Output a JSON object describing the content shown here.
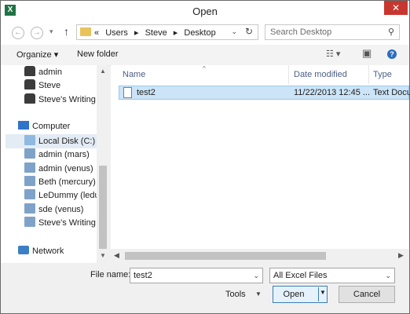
{
  "window": {
    "title": "Open",
    "app_icon": "excel-icon",
    "close_glyph": "✕"
  },
  "nav": {
    "back_glyph": "←",
    "forward_glyph": "→",
    "recent_glyph": "▾",
    "up_glyph": "↑",
    "crumb_prefix": "«",
    "breadcrumbs": [
      "Users",
      "Steve",
      "Desktop"
    ],
    "crumb_sep": "▸",
    "address_dropdown_glyph": "⌄",
    "refresh_glyph": "↻",
    "search_placeholder": "Search Desktop",
    "search_icon_glyph": "⚲"
  },
  "toolbar": {
    "organize_label": "Organize ▾",
    "new_folder_label": "New folder",
    "views_glyph": "☷ ▾",
    "preview_glyph": "▣",
    "help_glyph": "?"
  },
  "sidebar": {
    "users": [
      "admin",
      "Steve",
      "Steve's Writing"
    ],
    "computer_label": "Computer",
    "drives": [
      "Local Disk (C:)",
      "admin (mars)",
      "admin (venus)",
      "Beth (mercury)",
      "LeDummy (ledur",
      "sde (venus)",
      "Steve's Writing (r"
    ],
    "network_label": "Network",
    "selected": "Local Disk (C:)",
    "scroll_up": "▲",
    "scroll_down": "▼"
  },
  "filelist": {
    "columns": [
      "Name",
      "Date modified",
      "Type"
    ],
    "sort_glyph": "^",
    "rows": [
      {
        "name": "test2",
        "date": "11/22/2013 12:45 ...",
        "type": "Text Docu"
      }
    ],
    "scroll_left": "◀",
    "scroll_right": "▶"
  },
  "bottom": {
    "file_name_label": "File name:",
    "file_name_value": "test2",
    "file_name_dropdown": "⌄",
    "file_type_value": "All Excel Files",
    "file_type_dropdown": "⌄",
    "tools_label": "Tools",
    "tools_caret": "▼",
    "open_label": "Open",
    "open_caret": "▼",
    "cancel_label": "Cancel"
  },
  "colors": {
    "selection": "#cce4f7",
    "close": "#c7372f",
    "excel": "#207245"
  }
}
